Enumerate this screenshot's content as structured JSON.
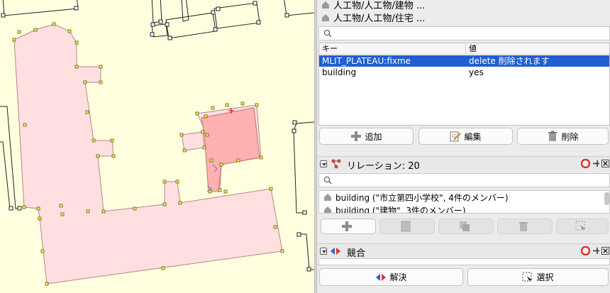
{
  "breadcrumbs": [
    "人工物/人工物/建物 ...",
    "人工物/人工物/住宅 ..."
  ],
  "tags": {
    "columns": {
      "key": "キー",
      "value": "値"
    },
    "rows": [
      {
        "key": "MLIT_PLATEAU:fixme",
        "value": "delete 削除されます",
        "selected": true
      },
      {
        "key": "building",
        "value": "yes",
        "selected": false
      }
    ],
    "buttons": {
      "add": "追加",
      "edit": "編集",
      "delete": "削除"
    }
  },
  "relations": {
    "title": "リレーション: 20",
    "items": [
      "building (\"市立第四小学校\", 4件のメンバー)",
      "building (\"建物\", 3件のメンバー)"
    ]
  },
  "conflicts": {
    "title": "競合",
    "buttons": {
      "resolve": "解決",
      "select": "選択"
    }
  },
  "colors": {
    "map_background": "#ffffe0",
    "building_fill": "#ffdfdf",
    "selected_fill": "#ffb0b0",
    "node": "#ffff00",
    "selection_highlight": "#1f5fd1"
  }
}
